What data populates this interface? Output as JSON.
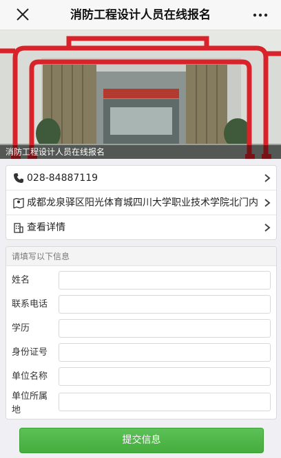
{
  "header": {
    "title": "消防工程设计人员在线报名",
    "close_icon": "close-icon",
    "more_icon": "more-icon"
  },
  "banner": {
    "caption": "消防工程设计人员在线报名"
  },
  "info": {
    "phone": "028-84887119",
    "address": "成都龙泉驿区阳光体育城四川大学职业技术学院北门内",
    "details": "查看详情"
  },
  "form": {
    "header": "请填写以下信息",
    "fields": [
      {
        "label": "姓名",
        "value": "",
        "placeholder": ""
      },
      {
        "label": "联系电话",
        "value": "",
        "placeholder": ""
      },
      {
        "label": "学历",
        "value": "",
        "placeholder": ""
      },
      {
        "label": "身份证号",
        "value": "",
        "placeholder": ""
      },
      {
        "label": "单位名称",
        "value": "",
        "placeholder": ""
      },
      {
        "label": "单位所属地",
        "value": "",
        "placeholder": ""
      }
    ],
    "submit_label": "提交信息"
  },
  "colors": {
    "accent_green": "#4cb545",
    "pipe_red": "#d9232a"
  }
}
